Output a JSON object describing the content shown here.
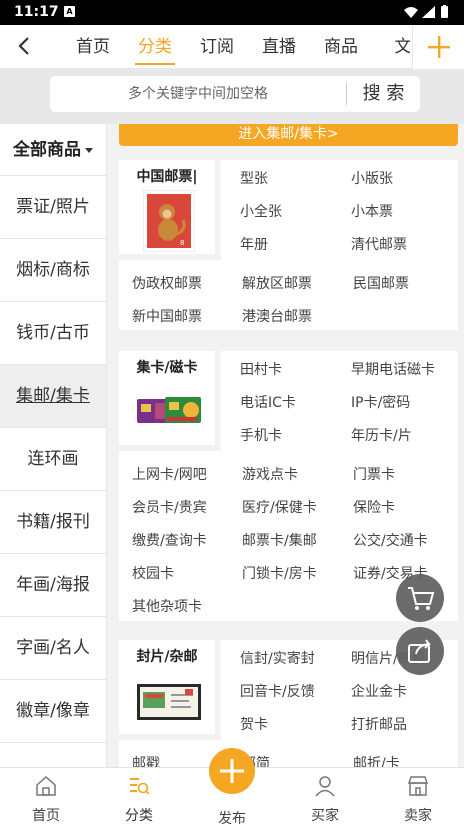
{
  "status_bar": {
    "time": "11:17",
    "notif_glyph": "A"
  },
  "top_tabs": [
    {
      "label": "首页",
      "active": false
    },
    {
      "label": "分类",
      "active": true
    },
    {
      "label": "订阅",
      "active": false
    },
    {
      "label": "直播",
      "active": false
    },
    {
      "label": "商品",
      "active": false
    },
    {
      "label": "文",
      "active": false
    }
  ],
  "search": {
    "placeholder": "多个关键字中间加空格",
    "button": "搜 索"
  },
  "sidebar": {
    "header": "全部商品",
    "items": [
      {
        "label": "票证/照片"
      },
      {
        "label": "烟标/商标"
      },
      {
        "label": "钱币/古币"
      },
      {
        "label": "集邮/集卡",
        "active": true
      },
      {
        "label": "连环画"
      },
      {
        "label": "书籍/报刊"
      },
      {
        "label": "年画/海报"
      },
      {
        "label": "字画/名人"
      },
      {
        "label": "徽章/像章"
      }
    ]
  },
  "enter_button": "进入集邮/集卡>",
  "sections": [
    {
      "title": "中国邮票|",
      "image_icon": "monkey-stamp-icon",
      "side": [
        "型张",
        "小版张",
        "小全张",
        "小本票",
        "年册",
        "清代邮票"
      ],
      "grid": [
        "伪政权邮票",
        "解放区邮票",
        "民国邮票",
        "新中国邮票",
        "港澳台邮票"
      ]
    },
    {
      "title": "集卡/磁卡",
      "image_icon": "phone-cards-icon",
      "side": [
        "田村卡",
        "早期电话磁卡",
        "电话IC卡",
        "IP卡/密码",
        "手机卡",
        "年历卡/片"
      ],
      "grid": [
        "上网卡/网吧",
        "游戏点卡",
        "门票卡",
        "会员卡/贵宾",
        "医疗/保健卡",
        "保险卡",
        "缴费/查询卡",
        "邮票卡/集邮",
        "公交/交通卡",
        "校园卡",
        "门锁卡/房卡",
        "证券/交易卡",
        "其他杂项卡"
      ]
    },
    {
      "title": "封片/杂邮",
      "image_icon": "envelope-icon",
      "side": [
        "信封/实寄封",
        "明信片/邮资",
        "回音卡/反馈",
        "企业金卡",
        "贺卡",
        "打折邮品"
      ],
      "grid": [
        "邮戳",
        "邮简",
        "邮折/卡"
      ]
    }
  ],
  "floating": {
    "cart_icon": "cart-icon",
    "share_icon": "share-icon"
  },
  "bottom_nav": [
    {
      "label": "首页",
      "icon": "home-icon"
    },
    {
      "label": "分类",
      "icon": "category-icon",
      "active": true
    },
    {
      "label": "发布",
      "icon": "publish-plus-icon"
    },
    {
      "label": "买家",
      "icon": "buyer-icon"
    },
    {
      "label": "卖家",
      "icon": "seller-icon"
    }
  ],
  "colors": {
    "accent": "#f5a623",
    "stamp_red": "#d9473a"
  }
}
